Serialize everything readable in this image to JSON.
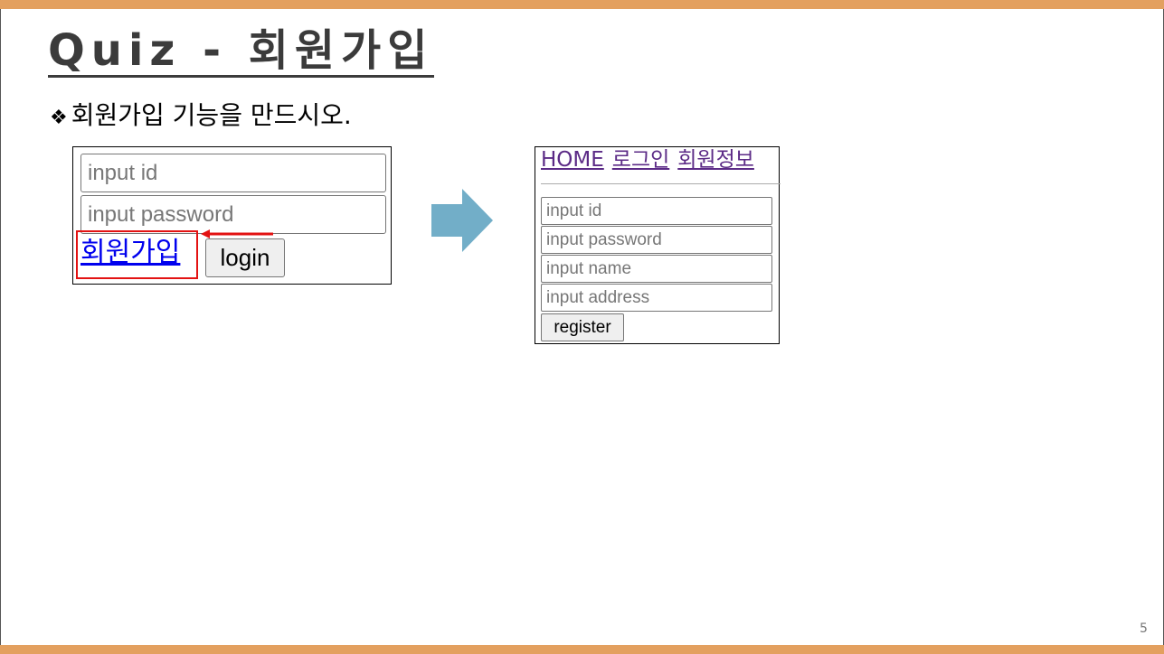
{
  "slide": {
    "title": "Quiz - 회원가입",
    "bullet_mark": "❖",
    "bullet_text": "회원가입 기능을 만드시오.",
    "page_number": "5"
  },
  "login_form": {
    "id_placeholder": "input id",
    "password_placeholder": "input password",
    "signup_link": "회원가입",
    "login_button": "login"
  },
  "register_page": {
    "nav": [
      "HOME",
      "로그인",
      "회원정보"
    ],
    "inputs": [
      "input id",
      "input password",
      "input name",
      "input address"
    ],
    "register_button": "register"
  },
  "colors": {
    "band": "#e3a05f",
    "title": "#3b3b3b",
    "link": "#0000ee",
    "visited_link": "#5b2a86",
    "highlight": "#e31212",
    "arrow": "#72aec8"
  }
}
